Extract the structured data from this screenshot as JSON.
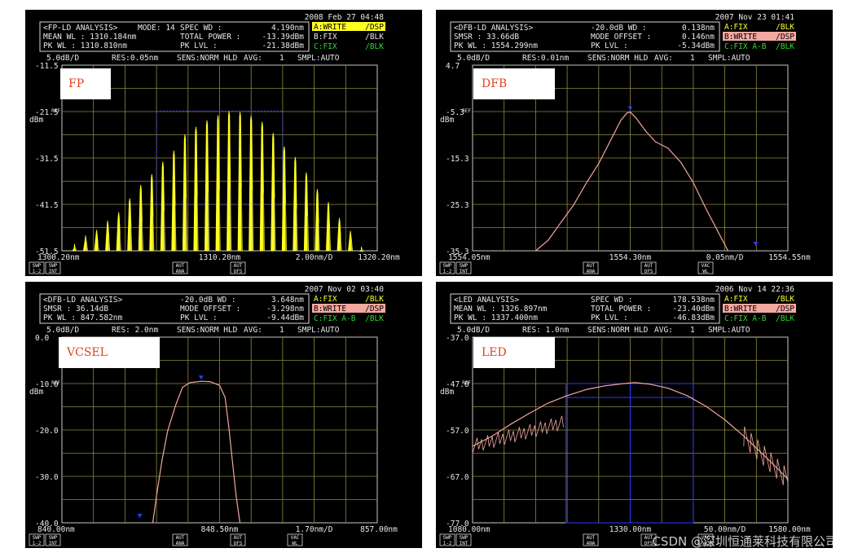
{
  "watermark": "CSDN @深圳恒通莱科技有限公司",
  "chart_data": [
    {
      "type": "line",
      "label": "FP",
      "mode": "spectrum-lines",
      "color_trace": "#ffff22",
      "datetime": "2008 Feb 27 04:48",
      "header_rows": [
        [
          "<FP-LD ANALYSIS>",
          "MODE: 14",
          "SPEC WD :",
          "4.190nm"
        ],
        [
          "MEAN WL : 1310.184nm",
          "",
          "TOTAL POWER :",
          "-13.39dBm"
        ],
        [
          "PK WL : 1310.810nm",
          "",
          "PK LVL :",
          "-21.38dBm"
        ]
      ],
      "traces": [
        {
          "label": "A:WRITE",
          "mode": "/DSP",
          "style": "yellow"
        },
        {
          "label": "B:FIX",
          "mode": "/BLK",
          "style": "plain"
        },
        {
          "label": "C:FIX",
          "mode": "/BLK",
          "style": "green"
        }
      ],
      "settings": [
        "5.0dB/D",
        "RES:0.05nm",
        "SENS:NORM HLD",
        "AVG:",
        "1",
        "SMPL:AUTO"
      ],
      "ref_label": "REF",
      "unit_label": "dBm",
      "y_ticks": [
        "-11.5",
        "-21.5",
        "-31.5",
        "-41.5",
        "-51.5"
      ],
      "x_start": "1300.20nm",
      "x_center": "1310.20nm",
      "x_span": "2.00nm/D",
      "x_end": "1320.20nm",
      "xlim": [
        1300.2,
        1320.2
      ],
      "ylim": [
        -51.5,
        -11.5
      ],
      "modes": [
        {
          "x": 1301.0,
          "y": -50.0
        },
        {
          "x": 1301.7,
          "y": -48.2
        },
        {
          "x": 1302.4,
          "y": -47.0
        },
        {
          "x": 1303.1,
          "y": -45.0
        },
        {
          "x": 1303.8,
          "y": -43.2
        },
        {
          "x": 1304.5,
          "y": -40.2
        },
        {
          "x": 1305.2,
          "y": -37.3
        },
        {
          "x": 1305.9,
          "y": -35.0
        },
        {
          "x": 1306.6,
          "y": -32.3
        },
        {
          "x": 1307.3,
          "y": -29.9
        },
        {
          "x": 1308.0,
          "y": -26.4
        },
        {
          "x": 1308.7,
          "y": -24.8
        },
        {
          "x": 1309.4,
          "y": -23.4
        },
        {
          "x": 1310.1,
          "y": -22.3
        },
        {
          "x": 1310.8,
          "y": -21.4
        },
        {
          "x": 1311.5,
          "y": -21.6
        },
        {
          "x": 1312.2,
          "y": -22.4
        },
        {
          "x": 1312.9,
          "y": -23.7
        },
        {
          "x": 1313.6,
          "y": -26.1
        },
        {
          "x": 1314.3,
          "y": -29.0
        },
        {
          "x": 1315.0,
          "y": -31.3
        },
        {
          "x": 1315.7,
          "y": -34.6
        },
        {
          "x": 1316.4,
          "y": -38.2
        },
        {
          "x": 1317.1,
          "y": -41.0
        },
        {
          "x": 1317.8,
          "y": -44.4
        },
        {
          "x": 1318.5,
          "y": -47.2
        },
        {
          "x": 1319.2,
          "y": -50.6
        }
      ],
      "soft_keys": [
        "SWP 1-2",
        "SWP INT",
        "AUT ANA",
        "AUT OFS"
      ]
    },
    {
      "type": "line",
      "label": "DFB",
      "mode": "curve",
      "color_trace": "#f3a8a0",
      "datetime": "2007 Nov 23 01:41",
      "header_rows": [
        [
          "<DFB-LD ANALYSIS>",
          "",
          "-20.0dB WD :",
          "0.138nm"
        ],
        [
          "SMSR : 33.66dB",
          "",
          "MODE OFFSET :",
          "0.146nm"
        ],
        [
          "PK WL : 1554.299nm",
          "",
          "PK LVL :",
          "-5.34dBm"
        ]
      ],
      "traces": [
        {
          "label": "A:FIX",
          "mode": "/BLK",
          "style": "yellow-text"
        },
        {
          "label": "B:WRITE",
          "mode": "/DSP",
          "style": "pink"
        },
        {
          "label": "C:FIX A-B",
          "mode": "/BLK",
          "style": "green"
        }
      ],
      "settings": [
        "5.0dB/D",
        "RES:0.01nm",
        "SENS:NORM HLD",
        "AVG:",
        "1",
        "SMPL:AUTO"
      ],
      "ref_label": "REF",
      "unit_label": "dBm",
      "y_ticks": [
        "4.7",
        "-5.3",
        "-15.3",
        "-25.3",
        "-35.3"
      ],
      "x_start": "1554.05nm",
      "x_center": "1554.30nm",
      "x_span": "0.05nm/D",
      "x_end": "1554.55nm",
      "xlim": [
        1554.05,
        1554.55
      ],
      "ylim": [
        -35.3,
        4.7
      ],
      "points": [
        [
          1554.15,
          -35.3
        ],
        [
          1554.17,
          -33.0
        ],
        [
          1554.19,
          -29.2
        ],
        [
          1554.21,
          -25.5
        ],
        [
          1554.23,
          -20.8
        ],
        [
          1554.25,
          -16.5
        ],
        [
          1554.27,
          -11.2
        ],
        [
          1554.285,
          -7.2
        ],
        [
          1554.295,
          -5.6
        ],
        [
          1554.3,
          -5.4
        ],
        [
          1554.31,
          -6.8
        ],
        [
          1554.325,
          -9.6
        ],
        [
          1554.34,
          -11.8
        ],
        [
          1554.36,
          -13.2
        ],
        [
          1554.38,
          -16.2
        ],
        [
          1554.4,
          -20.6
        ],
        [
          1554.42,
          -26.2
        ],
        [
          1554.44,
          -31.4
        ],
        [
          1554.455,
          -35.3
        ]
      ],
      "soft_keys": [
        "SWP 1-2",
        "SWP INT",
        "AUT ANA",
        "AUT OFS",
        "VAC WL"
      ]
    },
    {
      "type": "line",
      "label": "VCSEL",
      "mode": "curve",
      "color_trace": "#f3a8a0",
      "datetime": "2007 Nov 02 03:40",
      "header_rows": [
        [
          "<DFB-LD ANALYSIS>",
          "",
          "-20.0dB WD :",
          "3.648nm"
        ],
        [
          "SMSR : 36.14dB",
          "",
          "MODE OFFSET :",
          "-3.298nm"
        ],
        [
          "PK WL : 847.582nm",
          "",
          "PK LVL :",
          "-9.44dBm"
        ]
      ],
      "traces": [
        {
          "label": "A:FIX",
          "mode": "/BLK",
          "style": "yellow-text"
        },
        {
          "label": "B:WRITE",
          "mode": "/DSP",
          "style": "pink"
        },
        {
          "label": "C:FIX A-B",
          "mode": "/BLK",
          "style": "green"
        }
      ],
      "settings": [
        "5.0dB/D",
        "RES: 2.0nm",
        "SENS:NORM HLD",
        "AVG:",
        "1",
        "SMPL:AUTO"
      ],
      "ref_label": "REF",
      "unit_label": "dBm",
      "y_ticks": [
        "0.0",
        "-10.0",
        "-20.0",
        "-30.0",
        "-40.0"
      ],
      "x_start": "840.00nm",
      "x_center": "848.50nm",
      "x_span": "1.70nm/D",
      "x_end": "857.00nm",
      "xlim": [
        840.0,
        857.0
      ],
      "ylim": [
        -40.0,
        0.0
      ],
      "points": [
        [
          844.9,
          -40.0
        ],
        [
          845.1,
          -34.2
        ],
        [
          845.4,
          -26.5
        ],
        [
          845.7,
          -20.2
        ],
        [
          846.1,
          -15.0
        ],
        [
          846.5,
          -10.8
        ],
        [
          846.9,
          -9.8
        ],
        [
          847.5,
          -9.5
        ],
        [
          848.0,
          -9.6
        ],
        [
          848.5,
          -10.4
        ],
        [
          848.8,
          -13.0
        ],
        [
          849.0,
          -19.5
        ],
        [
          849.2,
          -27.0
        ],
        [
          849.4,
          -34.5
        ],
        [
          849.6,
          -40.0
        ]
      ],
      "soft_keys": [
        "SWP 1-2",
        "SWP INT",
        "AUT ANA",
        "AUT OFS",
        "VAC WL"
      ]
    },
    {
      "type": "line",
      "label": "LED",
      "mode": "curve",
      "color_trace": "#f3a8a0",
      "datetime": "2006 Nov 14 22:36",
      "header_rows": [
        [
          "<LED ANALYSIS>",
          "",
          "SPEC WD :",
          "178.538nm"
        ],
        [
          "MEAN WL : 1326.897nm",
          "",
          "TOTAL POWER :",
          "-23.40dBm"
        ],
        [
          "PK WL : 1337.400nm",
          "",
          "PK LVL :",
          "-46.83dBm"
        ]
      ],
      "traces": [
        {
          "label": "A:FIX",
          "mode": "/BLK",
          "style": "yellow-text"
        },
        {
          "label": "B:WRITE",
          "mode": "/DSP",
          "style": "pink"
        },
        {
          "label": "C:FIX A-B",
          "mode": "/BLK",
          "style": "green"
        }
      ],
      "settings": [
        "5.0dB/D",
        "RES: 1.0nm",
        "SENS:NORM HLD",
        "AVG:",
        "1",
        "SMPL:AUTO"
      ],
      "ref_label": "REF",
      "unit_label": "dBm",
      "y_ticks": [
        "-37.0",
        "-47.0",
        "-57.0",
        "-67.0",
        "-77.0"
      ],
      "x_start": "1080.00nm",
      "x_center": "1330.00nm",
      "x_span": "50.00nm/D",
      "x_end": "1580.00nm",
      "xlim": [
        1080.0,
        1580.0
      ],
      "ylim": [
        -77.0,
        -37.0
      ],
      "points": [
        [
          1080,
          -60.5
        ],
        [
          1110,
          -58.4
        ],
        [
          1140,
          -55.8
        ],
        [
          1170,
          -53.4
        ],
        [
          1200,
          -51.2
        ],
        [
          1230,
          -49.6
        ],
        [
          1260,
          -48.3
        ],
        [
          1290,
          -47.5
        ],
        [
          1320,
          -47.0
        ],
        [
          1337,
          -46.8
        ],
        [
          1360,
          -47.1
        ],
        [
          1390,
          -48.0
        ],
        [
          1420,
          -49.6
        ],
        [
          1450,
          -51.9
        ],
        [
          1480,
          -54.8
        ],
        [
          1510,
          -58.3
        ],
        [
          1540,
          -62.2
        ],
        [
          1565,
          -65.5
        ],
        [
          1580,
          -67.6
        ]
      ],
      "soft_keys": [
        "SWP 1-2",
        "SWP INT",
        "AUT ANA",
        "AUT OFS",
        "VAC WL"
      ]
    }
  ]
}
